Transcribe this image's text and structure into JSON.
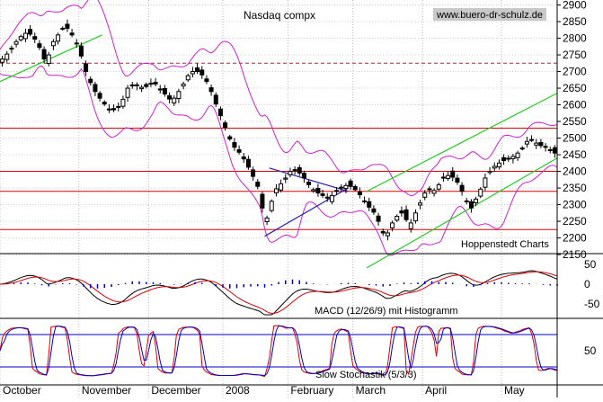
{
  "chart_data": {
    "type": "candlestick",
    "title": "Nasdaq compx",
    "watermark": "www.buero-dr-schulz.de",
    "source_note": "Hoppenstedt Charts",
    "months": [
      "October",
      "November",
      "December",
      "2008",
      "February",
      "March",
      "April",
      "May"
    ],
    "price_axis": {
      "ticks": [
        2150,
        2200,
        2250,
        2300,
        2350,
        2400,
        2450,
        2500,
        2550,
        2600,
        2650,
        2700,
        2750,
        2800,
        2850,
        2900
      ],
      "ylim": [
        2115,
        2915
      ]
    },
    "horizontal_levels": {
      "solid_red": [
        2225,
        2340,
        2400,
        2530
      ],
      "dashed": [
        2725
      ]
    },
    "price_series": [
      {
        "d": 0,
        "c": 2730
      },
      {
        "d": 4,
        "c": 2760
      },
      {
        "d": 8,
        "c": 2800
      },
      {
        "d": 12,
        "c": 2820
      },
      {
        "d": 16,
        "c": 2790
      },
      {
        "d": 20,
        "c": 2720
      },
      {
        "d": 22,
        "c": 2780
      },
      {
        "d": 25,
        "c": 2810
      },
      {
        "d": 28,
        "c": 2840
      },
      {
        "d": 31,
        "c": 2810
      },
      {
        "d": 34,
        "c": 2770
      },
      {
        "d": 37,
        "c": 2700
      },
      {
        "d": 40,
        "c": 2650
      },
      {
        "d": 44,
        "c": 2610
      },
      {
        "d": 48,
        "c": 2580
      },
      {
        "d": 52,
        "c": 2600
      },
      {
        "d": 55,
        "c": 2650
      },
      {
        "d": 58,
        "c": 2660
      },
      {
        "d": 62,
        "c": 2650
      },
      {
        "d": 66,
        "c": 2670
      },
      {
        "d": 70,
        "c": 2640
      },
      {
        "d": 74,
        "c": 2610
      },
      {
        "d": 78,
        "c": 2650
      },
      {
        "d": 82,
        "c": 2700
      },
      {
        "d": 86,
        "c": 2700
      },
      {
        "d": 90,
        "c": 2660
      },
      {
        "d": 92,
        "c": 2620
      },
      {
        "d": 96,
        "c": 2550
      },
      {
        "d": 100,
        "c": 2480
      },
      {
        "d": 104,
        "c": 2450
      },
      {
        "d": 108,
        "c": 2400
      },
      {
        "d": 112,
        "c": 2340
      },
      {
        "d": 114,
        "c": 2240
      },
      {
        "d": 116,
        "c": 2280
      },
      {
        "d": 118,
        "c": 2340
      },
      {
        "d": 122,
        "c": 2370
      },
      {
        "d": 126,
        "c": 2410
      },
      {
        "d": 130,
        "c": 2390
      },
      {
        "d": 134,
        "c": 2350
      },
      {
        "d": 138,
        "c": 2330
      },
      {
        "d": 142,
        "c": 2320
      },
      {
        "d": 146,
        "c": 2350
      },
      {
        "d": 150,
        "c": 2360
      },
      {
        "d": 154,
        "c": 2340
      },
      {
        "d": 158,
        "c": 2300
      },
      {
        "d": 162,
        "c": 2270
      },
      {
        "d": 164,
        "c": 2230
      },
      {
        "d": 166,
        "c": 2200
      },
      {
        "d": 170,
        "c": 2260
      },
      {
        "d": 174,
        "c": 2280
      },
      {
        "d": 176,
        "c": 2230
      },
      {
        "d": 180,
        "c": 2290
      },
      {
        "d": 184,
        "c": 2350
      },
      {
        "d": 188,
        "c": 2340
      },
      {
        "d": 190,
        "c": 2380
      },
      {
        "d": 194,
        "c": 2390
      },
      {
        "d": 198,
        "c": 2360
      },
      {
        "d": 200,
        "c": 2320
      },
      {
        "d": 203,
        "c": 2290
      },
      {
        "d": 206,
        "c": 2330
      },
      {
        "d": 209,
        "c": 2380
      },
      {
        "d": 212,
        "c": 2410
      },
      {
        "d": 216,
        "c": 2430
      },
      {
        "d": 220,
        "c": 2440
      },
      {
        "d": 224,
        "c": 2460
      },
      {
        "d": 228,
        "c": 2500
      },
      {
        "d": 232,
        "c": 2480
      },
      {
        "d": 236,
        "c": 2470
      },
      {
        "d": 238,
        "c": 2460
      },
      {
        "d": 240,
        "c": 2450
      }
    ],
    "channels": [
      {
        "name": "uptrend-oct",
        "color": "#22cc22",
        "from": [
          0,
          2670
        ],
        "to": [
          44,
          2810
        ]
      },
      {
        "name": "uptrend-upper",
        "color": "#22cc22",
        "from": [
          158,
          2340
        ],
        "to": [
          240,
          2635
        ]
      },
      {
        "name": "uptrend-lower",
        "color": "#22cc22",
        "from": [
          158,
          2110
        ],
        "to": [
          240,
          2440
        ]
      },
      {
        "name": "triangle-top",
        "color": "#2222aa",
        "from": [
          116,
          2410
        ],
        "to": [
          150,
          2340
        ]
      },
      {
        "name": "triangle-bottom",
        "color": "#2222aa",
        "from": [
          114,
          2205
        ],
        "to": [
          150,
          2350
        ]
      }
    ],
    "zero_axis": {
      "ticks": [
        50,
        0,
        -50
      ]
    },
    "macd_label": "MACD (12/26/9) mit Histogramm",
    "stochastic": {
      "ticks": [
        50
      ],
      "label": "Slow Stochastik (5/3/3)",
      "blue_lines": [
        80,
        20
      ]
    },
    "colors": {
      "red": "#dd0000",
      "bands": "#cc22cc",
      "trend": "#22cc22",
      "blue": "#0000cc",
      "macd_line": "#000000"
    }
  }
}
